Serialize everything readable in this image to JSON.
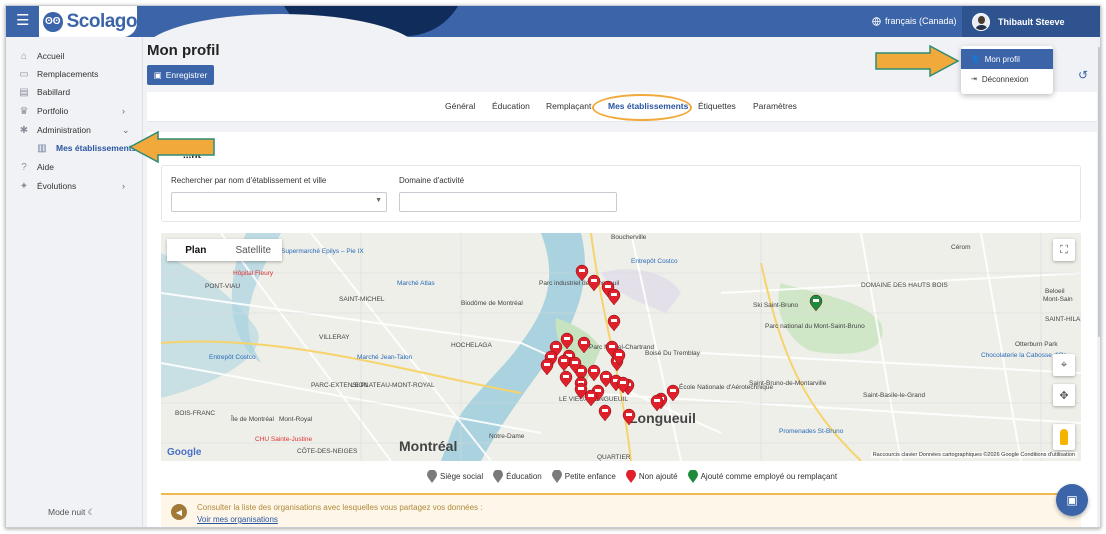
{
  "app": {
    "logo_text": "Scolago"
  },
  "header": {
    "language": "français (Canada)",
    "user_name": "Thibault Steeve"
  },
  "user_menu": {
    "items": [
      "Mon profil",
      "Déconnexion"
    ],
    "active_index": 0
  },
  "sidebar": {
    "items": [
      {
        "label": "Accueil",
        "icon": "home-icon"
      },
      {
        "label": "Remplacements",
        "icon": "photo-icon"
      },
      {
        "label": "Babillard",
        "icon": "board-icon"
      },
      {
        "label": "Portfolio",
        "icon": "trophy-icon",
        "chevron": "›"
      },
      {
        "label": "Administration",
        "icon": "gear-icon",
        "chevron": "⌄"
      },
      {
        "label": "Mes établissements",
        "icon": "school-icon",
        "sub": true
      },
      {
        "label": "Aide",
        "icon": "help-icon"
      },
      {
        "label": "Évolutions",
        "icon": "bulb-icon",
        "chevron": "›"
      }
    ],
    "night_mode": "Mode nuit"
  },
  "page": {
    "title": "Mon profil",
    "save_label": "Enregistrer"
  },
  "tabs": [
    "Général",
    "Éducation",
    "Remplaçant",
    "Mes établissements",
    "Étiquettes",
    "Paramètres"
  ],
  "active_tab": "Mes établissements",
  "section": {
    "title": "...nt"
  },
  "filters": {
    "search_label": "Rechercher par nom d'établissement et ville",
    "domain_label": "Domaine d'activité",
    "search_value": "",
    "domain_value": ""
  },
  "map": {
    "tab_plan": "Plan",
    "tab_satellite": "Satellite",
    "google": "Google",
    "attribution": "Raccourcis clavier   Données cartographiques ©2026 Google   Conditions d'utilisation",
    "places": [
      "Boucherville",
      "Entrepôt Costco",
      "Supermarché Epilys – Pie IX",
      "Hôpital Fleury",
      "PONT-VIAU",
      "Marché Atlas",
      "SAINT-MICHEL",
      "Biodôme de Montréal",
      "Parc industriel de Longueuil",
      "VILLERAY",
      "Entrepôt Costco",
      "Marché Jean-Talon",
      "HOCHELAGA",
      "Parc Michel-Chartrand",
      "Boisé Du Tremblay",
      "PARC-EXTENSION",
      "LE PLATEAU-MONT-ROYAL",
      "Île de Montréal",
      "Mont-Royal",
      "LE VIEUX-LONGUEUIL",
      "Longueuil",
      "CHU Sainte-Justine",
      "Montréal",
      "Notre-Dame",
      "École Nationale d'Aérotechnique",
      "Ski Saint-Bruno",
      "Parc national du Mont-Saint-Bruno",
      "Saint-Bruno-de-Montarville",
      "Saint-Basile-le-Grand",
      "Beloeil",
      "Mont-Sain",
      "Otterburn Park",
      "Chocolaterie la Cabosse d'Or",
      "Promenades St-Bruno",
      "Cérom",
      "DOMAINE DES HAUTS BOIS",
      "SAINT-HILAIRE",
      "CÔTE-DES-NEIGES",
      "BOIS-FRANC",
      "QUARTIER"
    ],
    "red_pin_count": 32,
    "green_pin_count": 1
  },
  "legend": [
    {
      "label": "Siège social",
      "color": "#7a7a7a"
    },
    {
      "label": "Éducation",
      "color": "#7a7a7a"
    },
    {
      "label": "Petite enfance",
      "color": "#7a7a7a"
    },
    {
      "label": "Non ajouté",
      "color": "#e0202a"
    },
    {
      "label": "Ajouté comme employé ou remplaçant",
      "color": "#1e8a3c"
    }
  ],
  "notice": {
    "text": "Consulter la liste des organisations avec lesquelles vous partagez vos données :",
    "link": "Voir mes organisations"
  },
  "colors": {
    "primary": "#3c64a8",
    "accent": "#f2a93b",
    "pin_red": "#e0202a",
    "pin_green": "#1e8a3c"
  }
}
